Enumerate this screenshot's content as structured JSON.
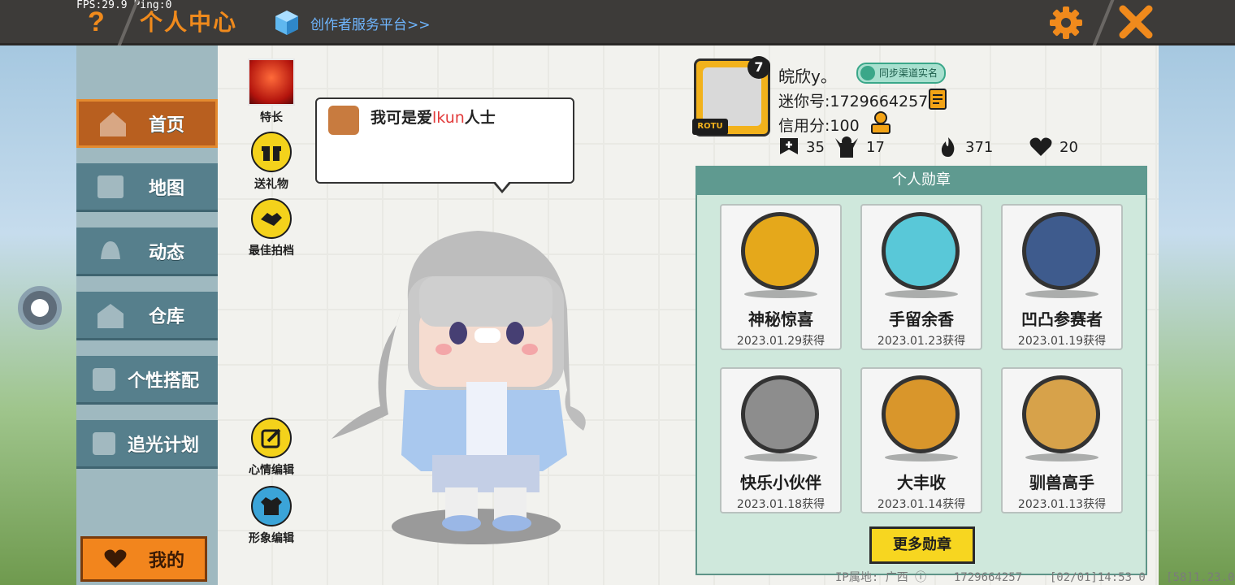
{
  "status": {
    "fps_ping": "FPS:29.9  Ping:0"
  },
  "header": {
    "help_icon_glyph": "?",
    "title": "个人中心",
    "creator_link": "创作者服务平台>>"
  },
  "menu": {
    "items": [
      {
        "label": "首页",
        "icon": "house-icon",
        "active": true
      },
      {
        "label": "地图",
        "icon": "map-icon",
        "active": false
      },
      {
        "label": "动态",
        "icon": "bell-icon",
        "active": false
      },
      {
        "label": "仓库",
        "icon": "warehouse-icon",
        "active": false
      },
      {
        "label": "个性搭配",
        "icon": "outfit-icon",
        "active": false
      },
      {
        "label": "追光计划",
        "icon": "plan-icon",
        "active": false
      }
    ],
    "my_label": "我的"
  },
  "actions": [
    {
      "label": "特长",
      "icon": "skill-icon"
    },
    {
      "label": "送礼物",
      "icon": "gift-icon"
    },
    {
      "label": "最佳拍档",
      "icon": "handshake-icon"
    },
    {
      "label": "心情编辑",
      "icon": "edit-icon"
    },
    {
      "label": "形象编辑",
      "icon": "costume-icon"
    }
  ],
  "mood": {
    "prefix": "我可是爱",
    "highlight": "lkun",
    "suffix": "人士"
  },
  "profile": {
    "level_badge": "7",
    "avatar_tag": "ROTU",
    "nickname": "皖欣y。",
    "sync_badge": "同步渠道实名",
    "mini_id": "迷你号:1729664257",
    "credit": "信用分:100",
    "stats": [
      {
        "icon": "plus-icon",
        "value": "35"
      },
      {
        "icon": "fans-icon",
        "value": "17"
      },
      {
        "icon": "fire-icon",
        "value": "371"
      },
      {
        "icon": "heart-pair-icon",
        "value": "20"
      }
    ]
  },
  "medals": {
    "header": "个人勋章",
    "items": [
      {
        "name": "神秘惊喜",
        "date": "2023.01.29获得",
        "color": "#e5a81b"
      },
      {
        "name": "手留余香",
        "date": "2023.01.23获得",
        "color": "#59c8d8"
      },
      {
        "name": "凹凸参赛者",
        "date": "2023.01.19获得",
        "color": "#3e5b8d"
      },
      {
        "name": "快乐小伙伴",
        "date": "2023.01.18获得",
        "color": "#8d8d8d"
      },
      {
        "name": "大丰收",
        "date": "2023.01.14获得",
        "color": "#d9962b"
      },
      {
        "name": "驯兽高手",
        "date": "2023.01.13获得",
        "color": "#d7a24a"
      }
    ],
    "more_button": "更多勋章"
  },
  "footer": {
    "text": "IP属地: 广西 ⓘ    1729664257    [02/01]14:53 0   [58]1.23.0"
  },
  "colors": {
    "accent": "#f08a1c",
    "menu": "#567f8c",
    "menu_active": "#b85f1f",
    "medal_header": "#5f9a90",
    "button_yellow": "#f7d620"
  }
}
